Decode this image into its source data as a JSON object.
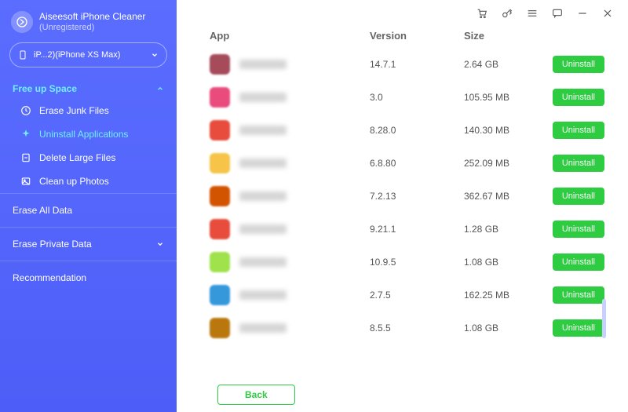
{
  "brand": {
    "title": "Aiseesoft iPhone Cleaner",
    "subtitle": "(Unregistered)"
  },
  "device": {
    "label": "iP...2)(iPhone XS Max)"
  },
  "sidebar": {
    "free_up": "Free up Space",
    "erase_junk": "Erase Junk Files",
    "uninstall_apps": "Uninstall Applications",
    "delete_large": "Delete Large Files",
    "clean_photos": "Clean up Photos",
    "erase_all": "Erase All Data",
    "erase_private": "Erase Private Data",
    "recommendation": "Recommendation"
  },
  "columns": {
    "app": "App",
    "version": "Version",
    "size": "Size"
  },
  "buttons": {
    "uninstall": "Uninstall",
    "back": "Back"
  },
  "apps": [
    {
      "version": "14.7.1",
      "size": "2.64 GB",
      "color": "#a64b5a"
    },
    {
      "version": "3.0",
      "size": "105.95 MB",
      "color": "#e94b7d"
    },
    {
      "version": "8.28.0",
      "size": "140.30 MB",
      "color": "#e74c3c"
    },
    {
      "version": "6.8.80",
      "size": "252.09 MB",
      "color": "#f6c448"
    },
    {
      "version": "7.2.13",
      "size": "362.67 MB",
      "color": "#d35400"
    },
    {
      "version": "9.21.1",
      "size": "1.28 GB",
      "color": "#e74c3c"
    },
    {
      "version": "10.9.5",
      "size": "1.08 GB",
      "color": "#9fe24b"
    },
    {
      "version": "2.7.5",
      "size": "162.25 MB",
      "color": "#3498db"
    },
    {
      "version": "8.5.5",
      "size": "1.08 GB",
      "color": "#b9770e"
    }
  ],
  "colors": {
    "sidebar_bg": "#5560f6",
    "accent": "#2ecc40",
    "cyan": "#6ef0ff"
  }
}
